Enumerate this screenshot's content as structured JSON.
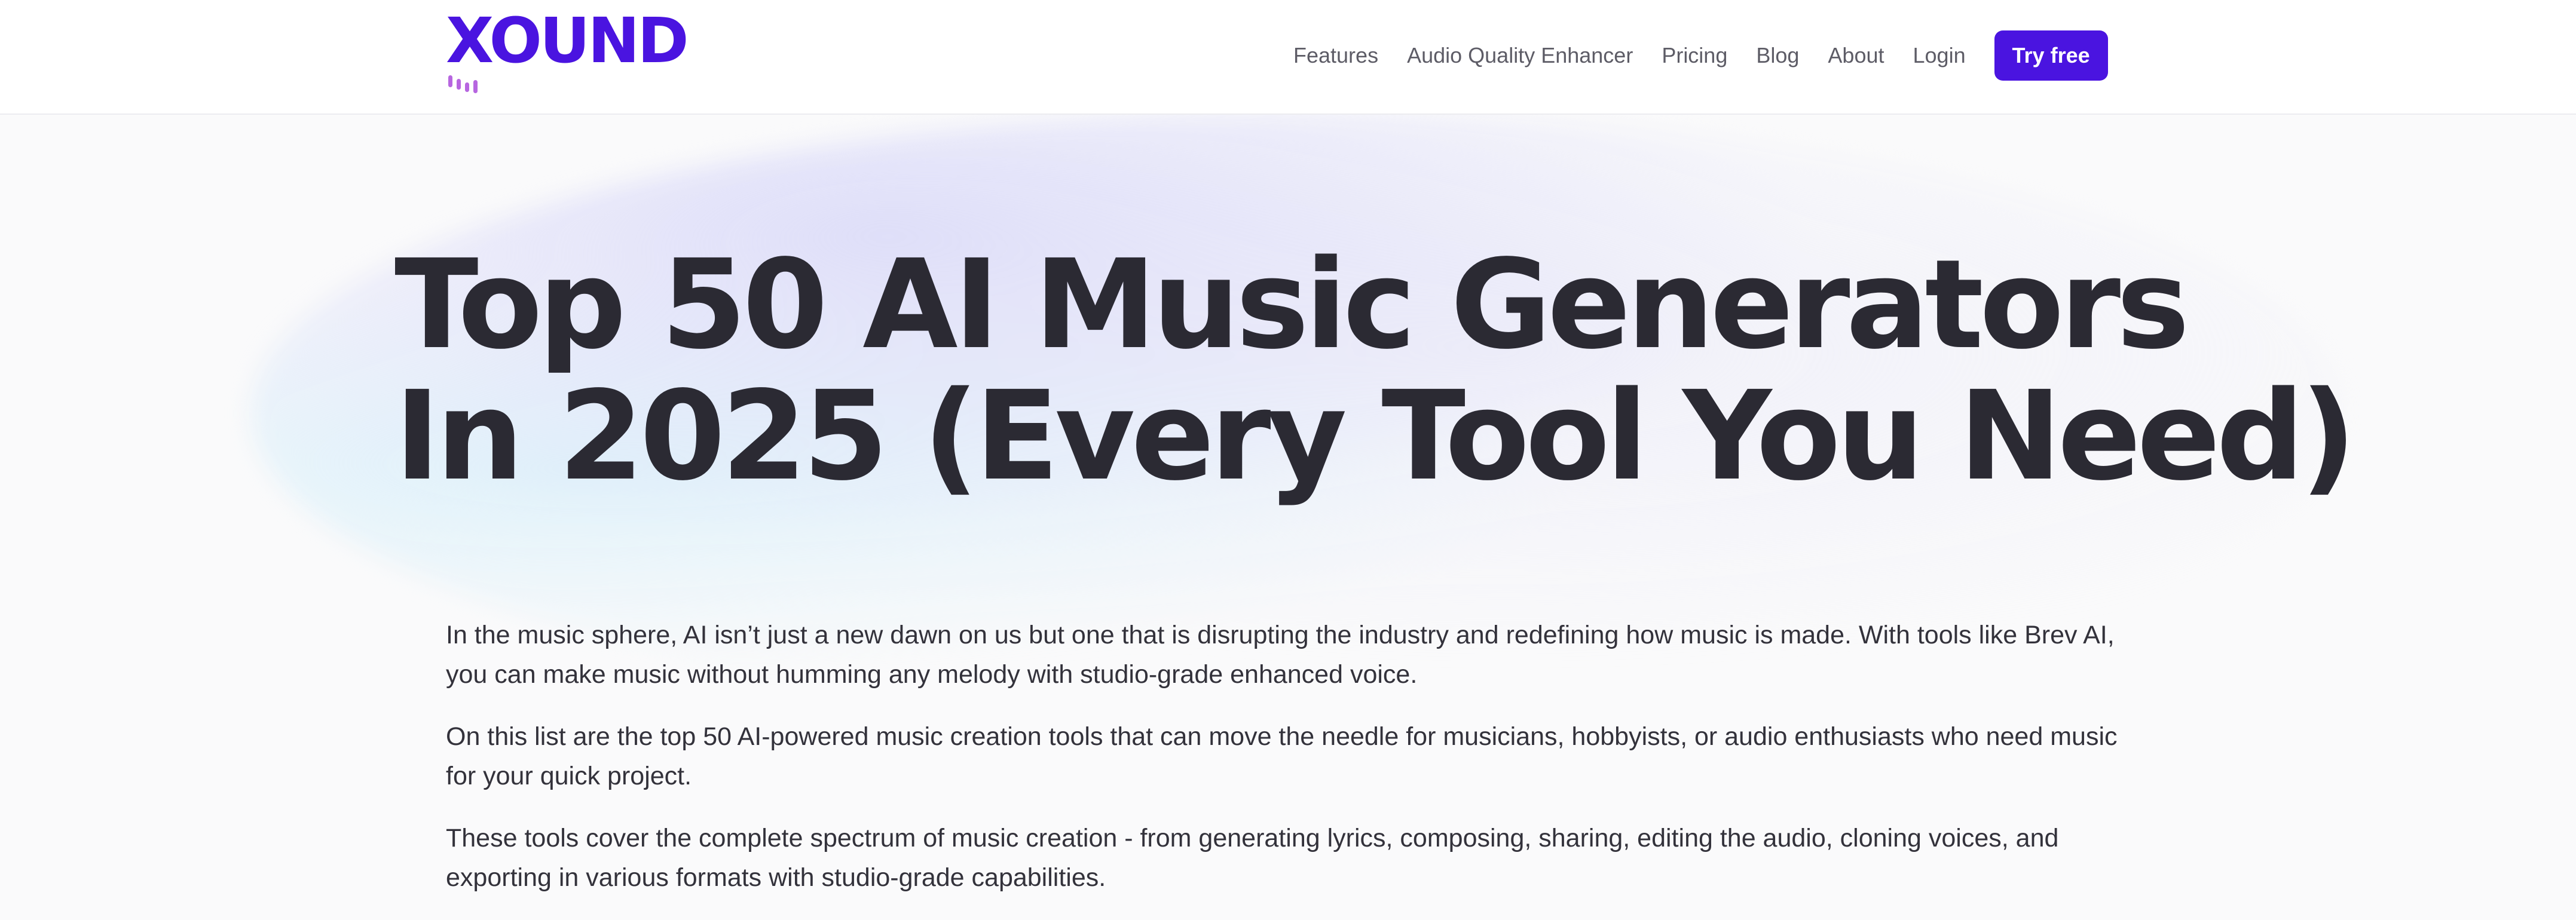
{
  "colors": {
    "brand": "#4a14e0",
    "text": "#2b2a33",
    "nav_text": "#5d5c66",
    "logo_bars": "#b766e0"
  },
  "logo": {
    "text": "XOUND"
  },
  "nav": {
    "items": [
      {
        "label": "Features"
      },
      {
        "label": "Audio Quality Enhancer"
      },
      {
        "label": "Pricing"
      },
      {
        "label": "Blog"
      },
      {
        "label": "About"
      },
      {
        "label": "Login"
      }
    ],
    "cta_label": "Try free"
  },
  "article": {
    "title_line1": "Top 50 AI Music Generators",
    "title_line2": "In 2025 (Every Tool You Need)",
    "paragraphs": [
      "In the music sphere, AI isn’t just a new dawn on us but one that is disrupting the industry and redefining how music is made. With tools like Brev AI, you can make music without humming any melody with studio-grade enhanced voice.",
      "On this list are the top 50 AI-powered music creation tools that can move the needle for musicians, hobbyists, or audio enthusiasts who need music for your quick project.",
      "These tools cover the complete spectrum of music creation - from generating lyrics, composing, sharing, editing the audio, cloning voices, and exporting in various formats with studio-grade capabilities."
    ]
  }
}
